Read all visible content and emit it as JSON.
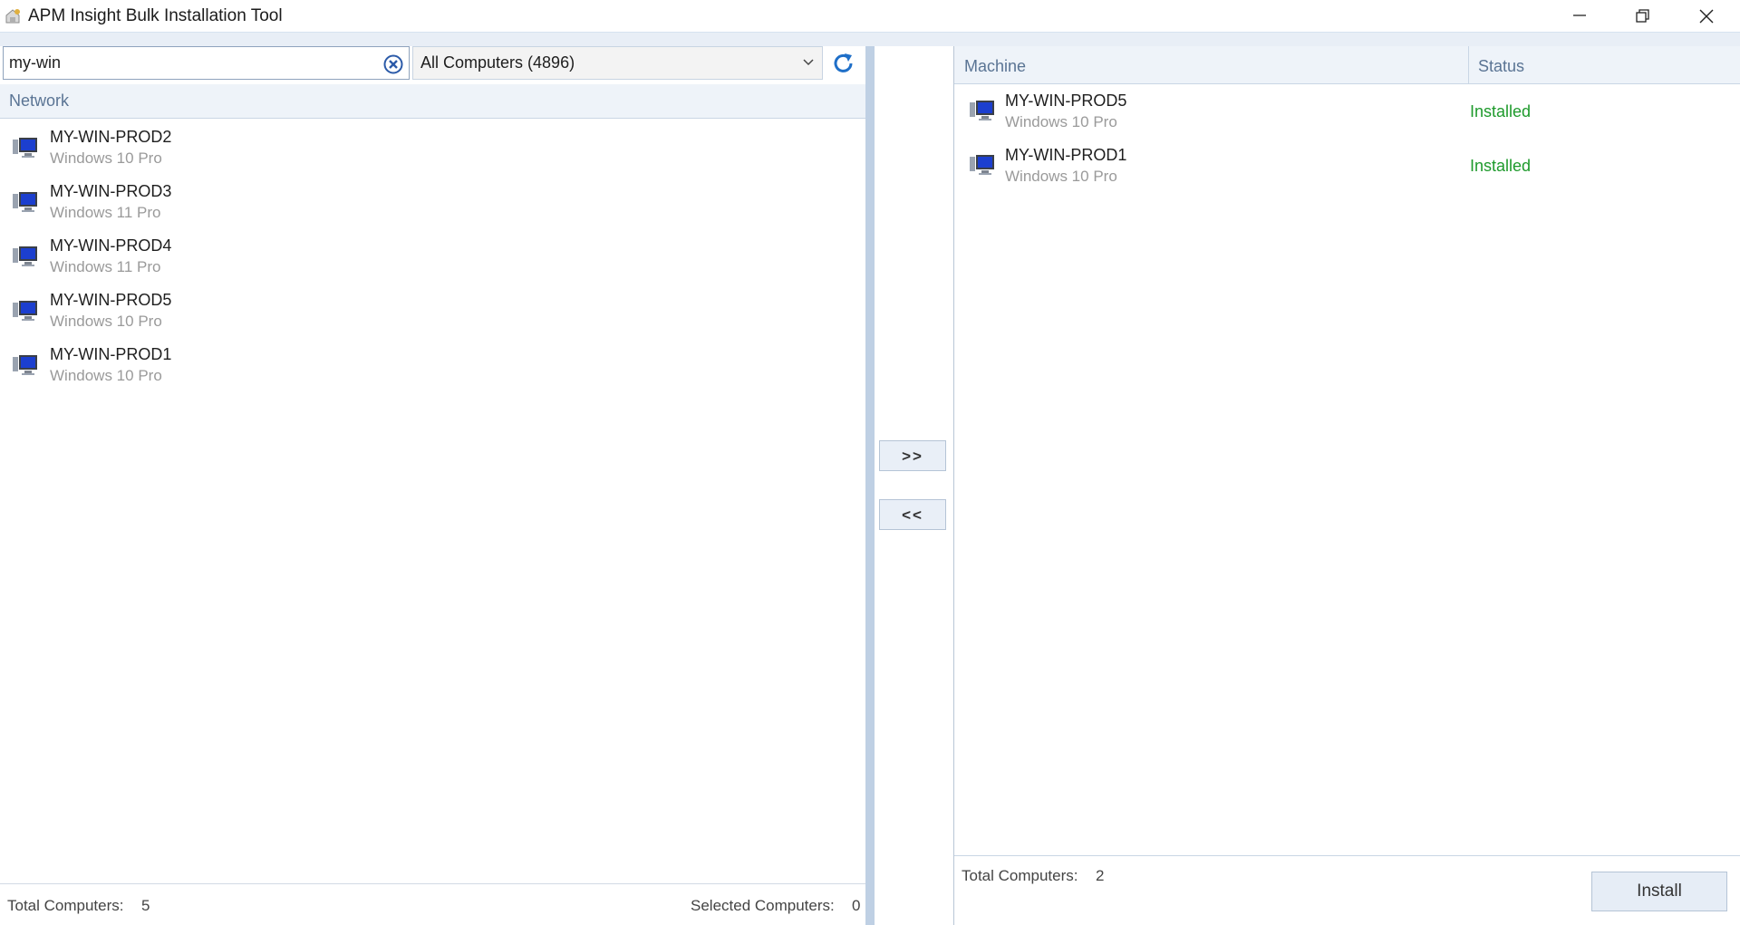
{
  "window": {
    "title": "APM Insight Bulk Installation Tool"
  },
  "search": {
    "value": "my-win"
  },
  "filter": {
    "selected": "All Computers (4896)"
  },
  "network": {
    "header": "Network",
    "items": [
      {
        "name": "MY-WIN-PROD2",
        "os": "Windows 10 Pro"
      },
      {
        "name": "MY-WIN-PROD3",
        "os": "Windows 11 Pro"
      },
      {
        "name": "MY-WIN-PROD4",
        "os": "Windows 11 Pro"
      },
      {
        "name": "MY-WIN-PROD5",
        "os": "Windows 10 Pro"
      },
      {
        "name": "MY-WIN-PROD1",
        "os": "Windows 10 Pro"
      }
    ]
  },
  "left_footer": {
    "total_label": "Total Computers:",
    "total_value": "5",
    "selected_label": "Selected Computers:",
    "selected_value": "0"
  },
  "transfer": {
    "add_label": ">>",
    "remove_label": "<<"
  },
  "selected_grid": {
    "col_machine": "Machine",
    "col_status": "Status",
    "status_color": "#1e9a2c",
    "rows": [
      {
        "name": "MY-WIN-PROD5",
        "os": "Windows 10 Pro",
        "status": "Installed"
      },
      {
        "name": "MY-WIN-PROD1",
        "os": "Windows 10 Pro",
        "status": "Installed"
      }
    ]
  },
  "right_footer": {
    "total_label": "Total Computers:",
    "total_value": "2",
    "install_label": "Install"
  }
}
